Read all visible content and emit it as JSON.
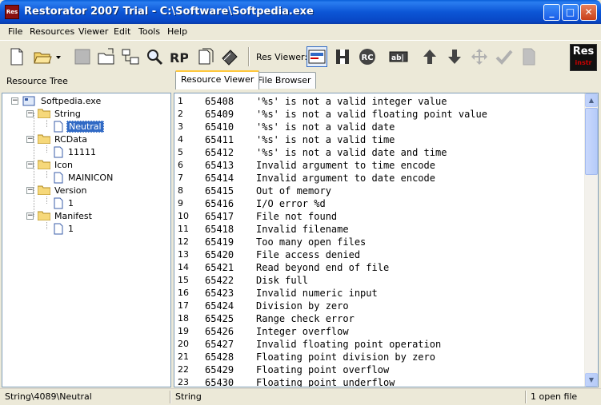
{
  "window": {
    "title": "Restorator 2007 Trial - C:\\Software\\Softpedia.exe",
    "app_icon_text": "Res"
  },
  "menu": [
    "File",
    "Resources",
    "Viewer",
    "Edit",
    "Tools",
    "Help"
  ],
  "toolbar": {
    "res_viewer_label": "Res Viewer:",
    "logo_text": "Res",
    "logo_sub": "instr"
  },
  "tree": {
    "header": "Resource Tree",
    "root": "Softpedia.exe",
    "folders": [
      {
        "label": "String",
        "child": "Neutral",
        "selected": true
      },
      {
        "label": "RCData",
        "child": "11111"
      },
      {
        "label": "Icon",
        "child": "MAINICON"
      },
      {
        "label": "Version",
        "child": "1"
      },
      {
        "label": "Manifest",
        "child": "1"
      }
    ]
  },
  "tabs": [
    "Resource Viewer",
    "File Browser"
  ],
  "rows": [
    [
      "1",
      "65408",
      "'%s' is not a valid integer value"
    ],
    [
      "2",
      "65409",
      "'%s' is not a valid floating point value"
    ],
    [
      "3",
      "65410",
      "'%s' is not a valid date"
    ],
    [
      "4",
      "65411",
      "'%s' is not a valid time"
    ],
    [
      "5",
      "65412",
      "'%s' is not a valid date and time"
    ],
    [
      "6",
      "65413",
      "Invalid argument to time encode"
    ],
    [
      "7",
      "65414",
      "Invalid argument to date encode"
    ],
    [
      "8",
      "65415",
      "Out of memory"
    ],
    [
      "9",
      "65416",
      "I/O error %d"
    ],
    [
      "10",
      "65417",
      "File not found"
    ],
    [
      "11",
      "65418",
      "Invalid filename"
    ],
    [
      "12",
      "65419",
      "Too many open files"
    ],
    [
      "13",
      "65420",
      "File access denied"
    ],
    [
      "14",
      "65421",
      "Read beyond end of file"
    ],
    [
      "15",
      "65422",
      "Disk full"
    ],
    [
      "16",
      "65423",
      "Invalid numeric input"
    ],
    [
      "17",
      "65424",
      "Division by zero"
    ],
    [
      "18",
      "65425",
      "Range check error"
    ],
    [
      "19",
      "65426",
      "Integer overflow"
    ],
    [
      "20",
      "65427",
      "Invalid floating point operation"
    ],
    [
      "21",
      "65428",
      "Floating point division by zero"
    ],
    [
      "22",
      "65429",
      "Floating point overflow"
    ],
    [
      "23",
      "65430",
      "Floating point underflow"
    ]
  ],
  "status": {
    "path": "String\\4089\\Neutral",
    "type": "String",
    "files": "1 open file"
  },
  "colors": {
    "title_blue": "#0a5fd8",
    "selection": "#316ac5",
    "tab_highlight": "#ffc83c"
  }
}
